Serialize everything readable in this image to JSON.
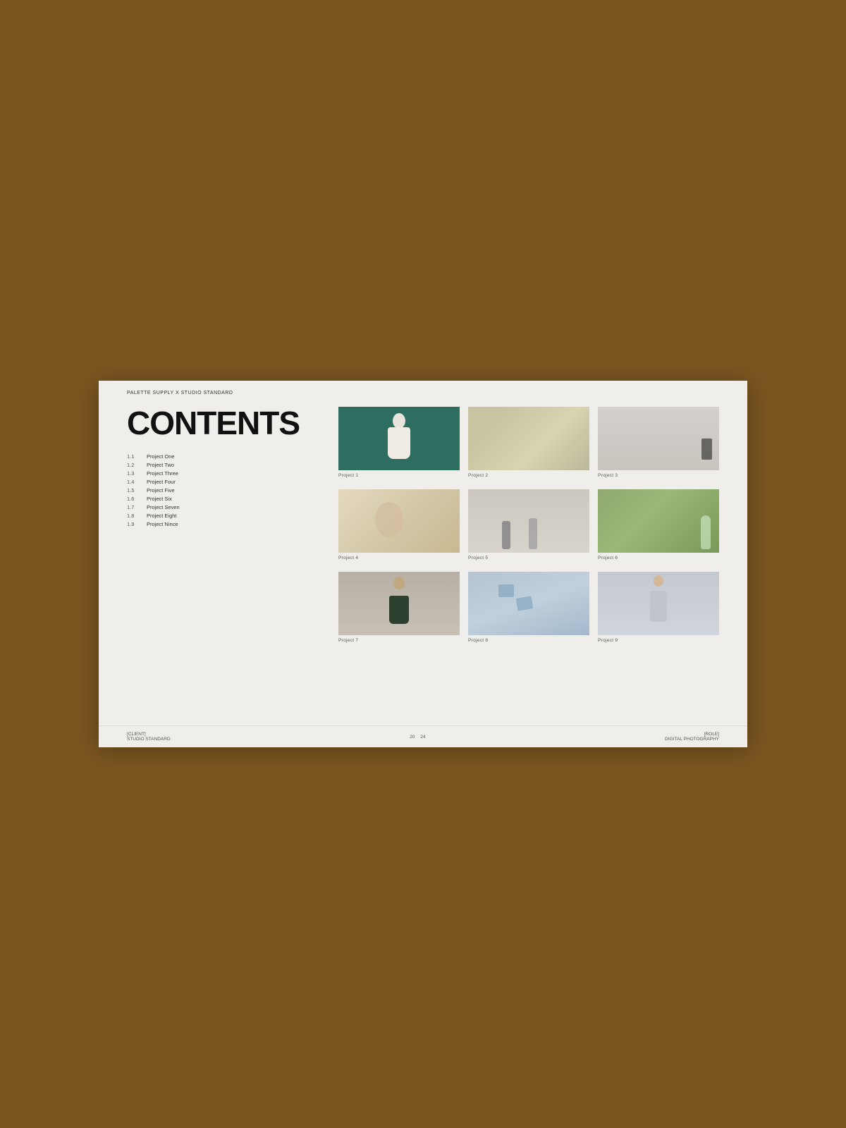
{
  "page": {
    "background_color": "#7a5520",
    "card_background": "#f0eeeb"
  },
  "header": {
    "brand": "PALETTE SUPPLY X STUDIO STANDARD"
  },
  "contents": {
    "title": "CONTENTS"
  },
  "toc": {
    "items": [
      {
        "number": "1.1",
        "label": "Project One"
      },
      {
        "number": "1.2",
        "label": "Project Two"
      },
      {
        "number": "1.3",
        "label": "Project Three"
      },
      {
        "number": "1.4",
        "label": "Project Four"
      },
      {
        "number": "1.5",
        "label": "Project Five"
      },
      {
        "number": "1.6",
        "label": "Project Six"
      },
      {
        "number": "1.7",
        "label": "Project Seven"
      },
      {
        "number": "1.8",
        "label": "Project Eight"
      },
      {
        "number": "1.9",
        "label": "Project Nince"
      }
    ]
  },
  "projects": [
    {
      "id": 1,
      "label": "Project 1"
    },
    {
      "id": 2,
      "label": "Project 2"
    },
    {
      "id": 3,
      "label": "Project 3"
    },
    {
      "id": 4,
      "label": "Project 4"
    },
    {
      "id": 5,
      "label": "Project 5"
    },
    {
      "id": 6,
      "label": "Project 6"
    },
    {
      "id": 7,
      "label": "Project 7"
    },
    {
      "id": 8,
      "label": "Project 8"
    },
    {
      "id": 9,
      "label": "Project 9"
    }
  ],
  "footer": {
    "client_label": "[CLIENT]",
    "client_value": "STUDIO STANDARD",
    "page_current": "20",
    "page_total": "24",
    "role_label": "[ROLE]",
    "role_value": "DIGITAL PHOTOGRAPHY"
  }
}
